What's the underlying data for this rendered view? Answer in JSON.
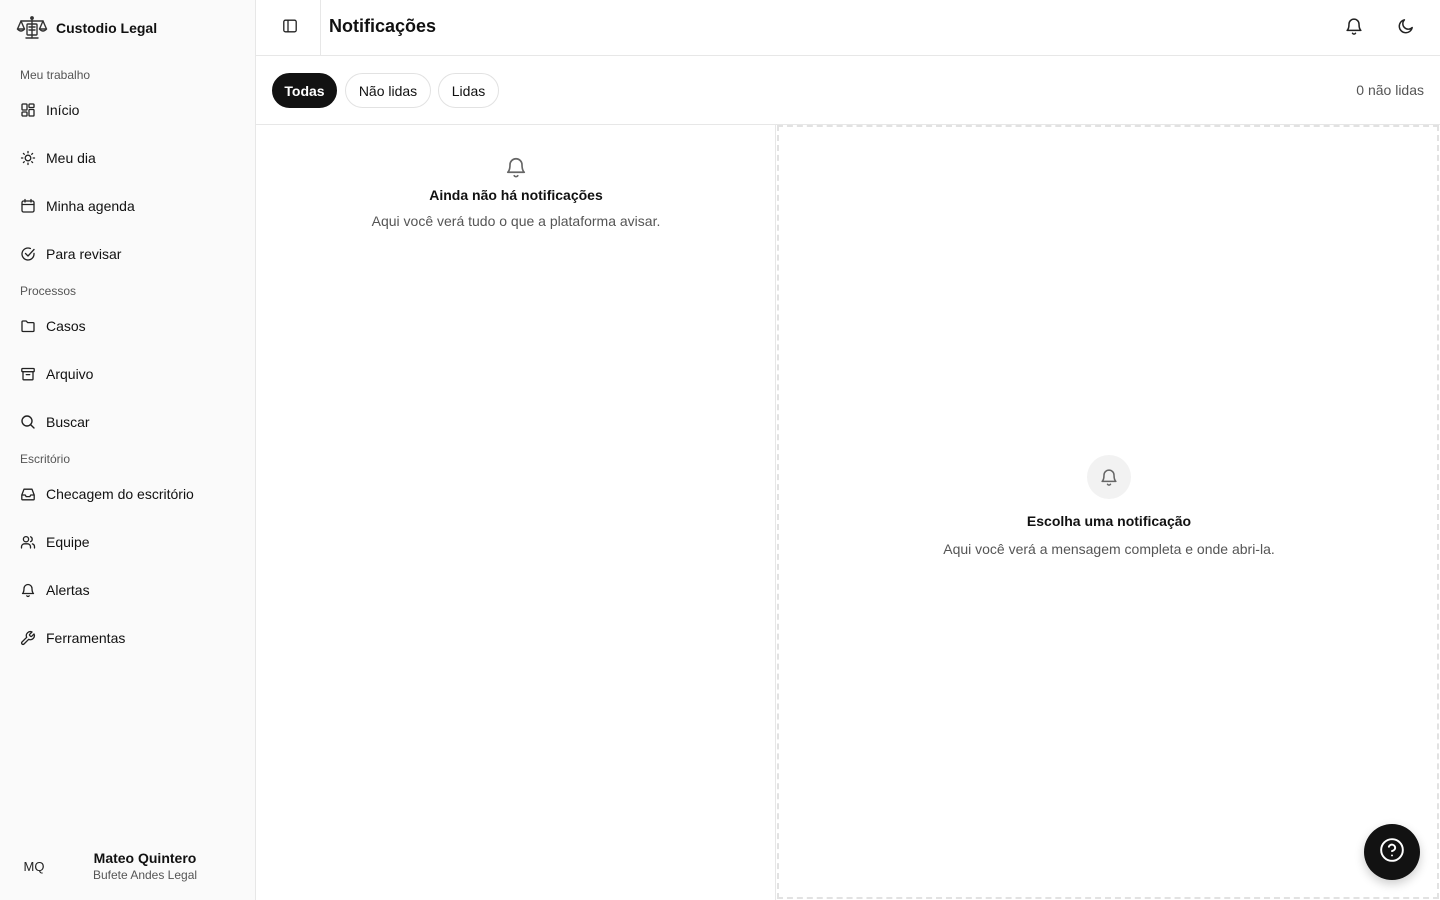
{
  "app": {
    "name": "Custodio Legal",
    "logo_icon": "scales-of-justice-icon"
  },
  "sidebar": {
    "sections": [
      {
        "label": "Meu trabalho",
        "items": [
          {
            "label": "Início",
            "icon": "dashboard-grid-icon"
          },
          {
            "label": "Meu dia",
            "icon": "sun-icon"
          },
          {
            "label": "Minha agenda",
            "icon": "calendar-icon"
          },
          {
            "label": "Para revisar",
            "icon": "check-circle-icon"
          }
        ]
      },
      {
        "label": "Processos",
        "items": [
          {
            "label": "Casos",
            "icon": "folder-icon"
          },
          {
            "label": "Arquivo",
            "icon": "archive-icon"
          },
          {
            "label": "Buscar",
            "icon": "search-icon"
          }
        ]
      },
      {
        "label": "Escritório",
        "items": [
          {
            "label": "Checagem do escritório",
            "icon": "inbox-icon"
          },
          {
            "label": "Equipe",
            "icon": "users-icon"
          },
          {
            "label": "Alertas",
            "icon": "bell-icon"
          },
          {
            "label": "Ferramentas",
            "icon": "wrench-icon"
          }
        ]
      }
    ],
    "user": {
      "initials": "MQ",
      "name": "Mateo Quintero",
      "org": "Bufete Andes Legal"
    }
  },
  "header": {
    "title": "Notificações",
    "toggle_icon": "sidebar-toggle-icon",
    "bell_icon": "bell-icon",
    "theme_icon": "moon-icon"
  },
  "filters": {
    "tabs": [
      {
        "label": "Todas",
        "active": true
      },
      {
        "label": "Não lidas",
        "active": false
      },
      {
        "label": "Lidas",
        "active": false
      }
    ],
    "unread_count": "0 não lidas"
  },
  "list": {
    "empty_title": "Ainda não há notificações",
    "empty_subtitle": "Aqui você verá tudo o que a plataforma avisar."
  },
  "detail": {
    "empty_title": "Escolha uma notificação",
    "empty_subtitle": "Aqui você verá a mensagem completa e onde abri-la."
  },
  "help": {
    "icon": "help-circle-icon"
  },
  "colors": {
    "accent": "#121212",
    "sidebar_bg": "#fafafa",
    "border": "#e7e7e7",
    "muted_text": "#555555"
  }
}
